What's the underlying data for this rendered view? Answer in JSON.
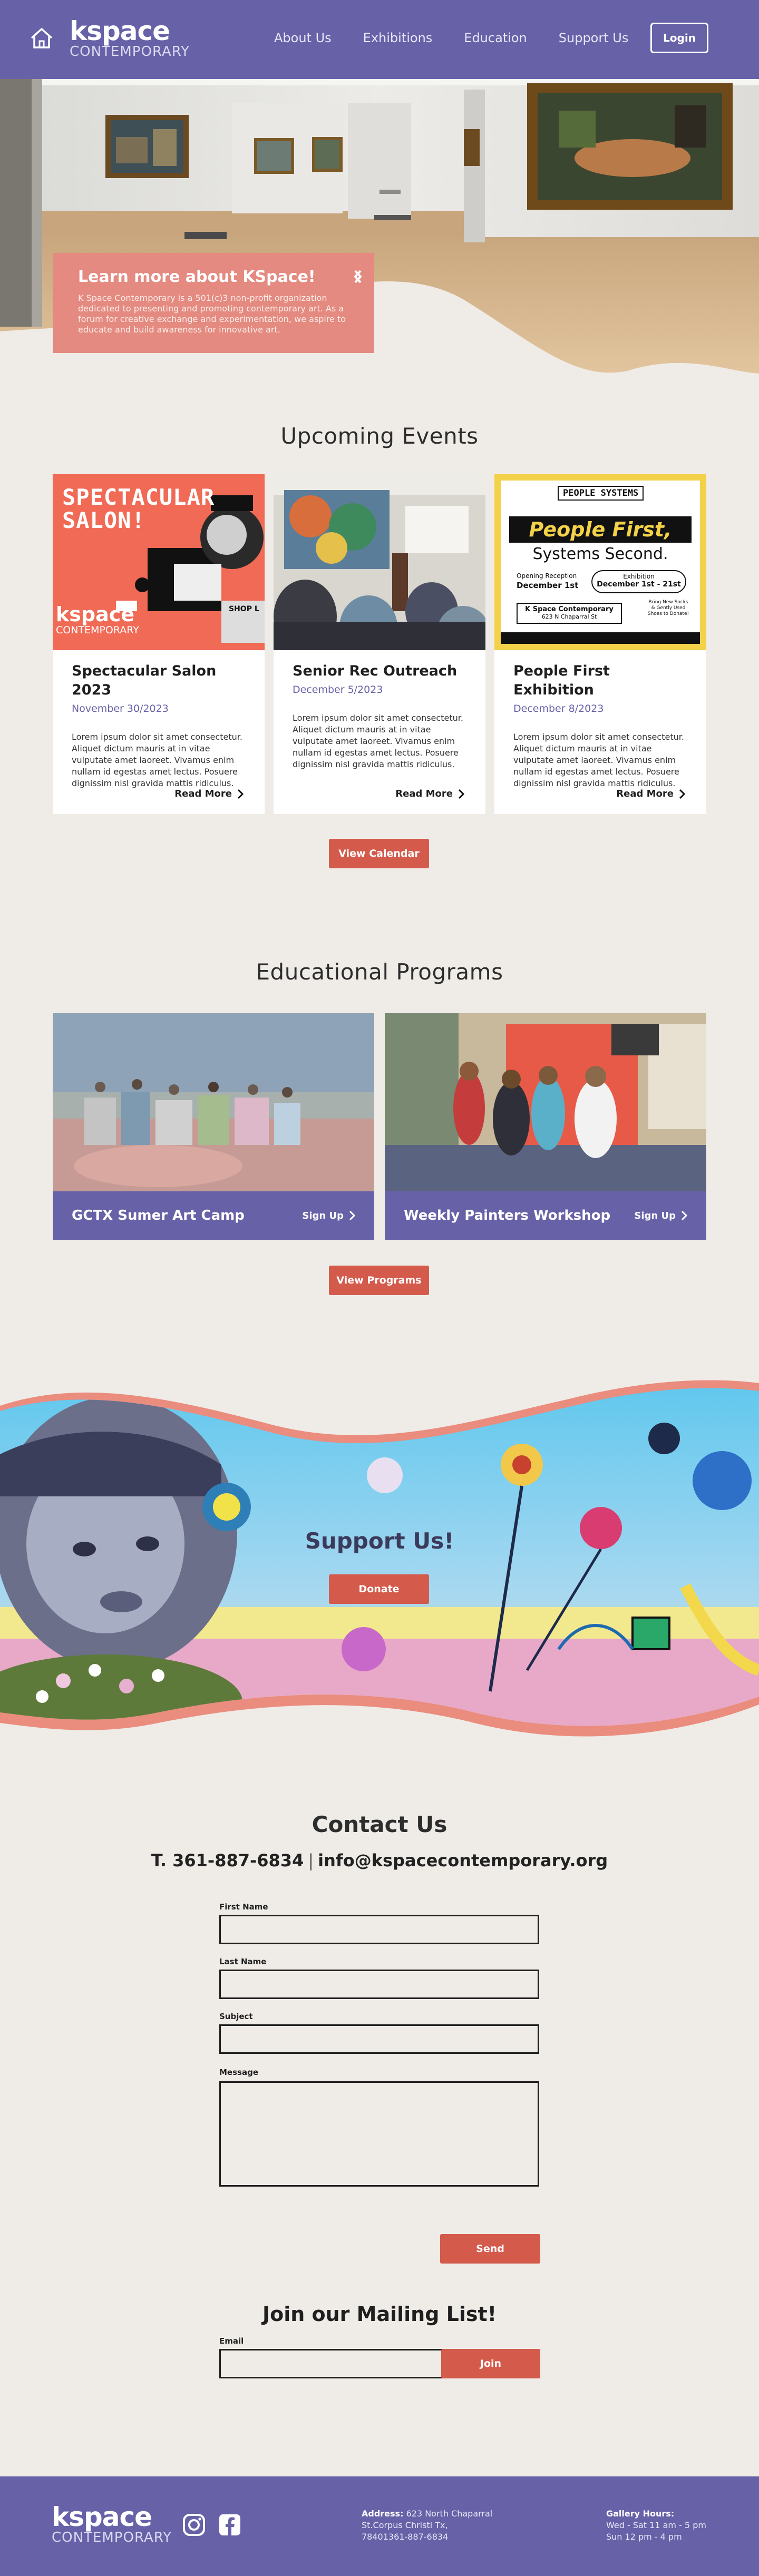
{
  "nav": {
    "logo_main": "kspace",
    "logo_sub": "CONTEMPORARY",
    "links": [
      "About Us",
      "Exhibitions",
      "Education",
      "Support Us"
    ],
    "login_label": "Login"
  },
  "hero": {
    "title": "Learn more about KSpace!",
    "text": "K Space Contemporary is a 501(c)3 non-profit organization dedicated to presenting and promoting contemporary art. As a forum for creative exchange and experimentation, we aspire to educate and build awareness for innovative art."
  },
  "events": {
    "title": "Upcoming Events",
    "items": [
      {
        "title": "Spectacular Salon 2023",
        "date": "November 30/2023",
        "desc": "Lorem ipsum dolor sit amet consectetur. Aliquet dictum mauris at in vitae vulputate amet laoreet. Vivamus enim nullam id egestas amet lectus. Posuere dignissim nisl gravida mattis ridiculus.",
        "read_more": "Read More",
        "poster_title": "SPECTACULAR SALON!",
        "poster_logo": "kspace",
        "poster_logo_sub": "CONTEMPORARY",
        "poster_tag": "SHOP L"
      },
      {
        "title": "Senior Rec Outreach",
        "date": "December 5/2023",
        "desc": "Lorem ipsum dolor sit amet consectetur. Aliquet dictum mauris at in vitae vulputate amet laoreet. Vivamus enim nullam id egestas amet lectus. Posuere dignissim nisl gravida mattis ridiculus.",
        "read_more": "Read More"
      },
      {
        "title": "People First Exhibition",
        "date": "December 8/2023",
        "desc": "Lorem ipsum dolor sit amet consectetur. Aliquet dictum mauris at in vitae vulputate amet laoreet. Vivamus enim nullam id egestas amet lectus. Posuere dignissim nisl gravida mattis ridiculus.",
        "read_more": "Read More",
        "poster_top": "PEOPLE SYSTEMS",
        "poster_title": "People First,",
        "poster_sub": "Systems Second.",
        "poster_reception_label": "Opening Reception",
        "poster_reception_date": "December 1st",
        "poster_exhibit_label": "Exhibition",
        "poster_exhibit_date": "December 1st - 21st",
        "poster_venue": "K Space Contemporary",
        "poster_venue_addr": "623 N Chaparral St",
        "poster_note": "Bring New Socks & Gently Used Shoes to Donate!"
      }
    ],
    "calendar_label": "View Calendar"
  },
  "programs": {
    "title": "Educational Programs",
    "items": [
      {
        "name": "GCTX Sumer Art Camp",
        "signup": "Sign Up"
      },
      {
        "name": "Weekly Painters Workshop",
        "signup": "Sign Up"
      }
    ],
    "view_label": "View Programs"
  },
  "support": {
    "title": "Support Us!",
    "donate_label": "Donate"
  },
  "contact": {
    "title": "Contact Us",
    "phone": "T. 361-887-6834",
    "separator": "|",
    "email": "info@kspacecontemporary.org",
    "fields": {
      "first_name": "First Name",
      "last_name": "Last Name",
      "subject": "Subject",
      "message": "Message"
    },
    "send_label": "Send"
  },
  "mailing": {
    "title": "Join our Mailing List!",
    "email_label": "Email",
    "join_label": "Join"
  },
  "footer": {
    "logo_main": "kspace",
    "logo_sub": "CONTEMPORARY",
    "address_label": "Address:",
    "address_line1": "623 North Chaparral",
    "address_line2": "St.Corpus Christi Tx,",
    "address_line3": "78401361-887-6834",
    "hours_label": "Gallery Hours:",
    "hours_line1": "Wed - Sat 11 am - 5 pm",
    "hours_line2": "Sun 12 pm - 4 pm"
  },
  "colors": {
    "brand_purple": "#6762a8",
    "coral": "#e48a80",
    "button_red": "#d45a4c",
    "background": "#efece7"
  }
}
